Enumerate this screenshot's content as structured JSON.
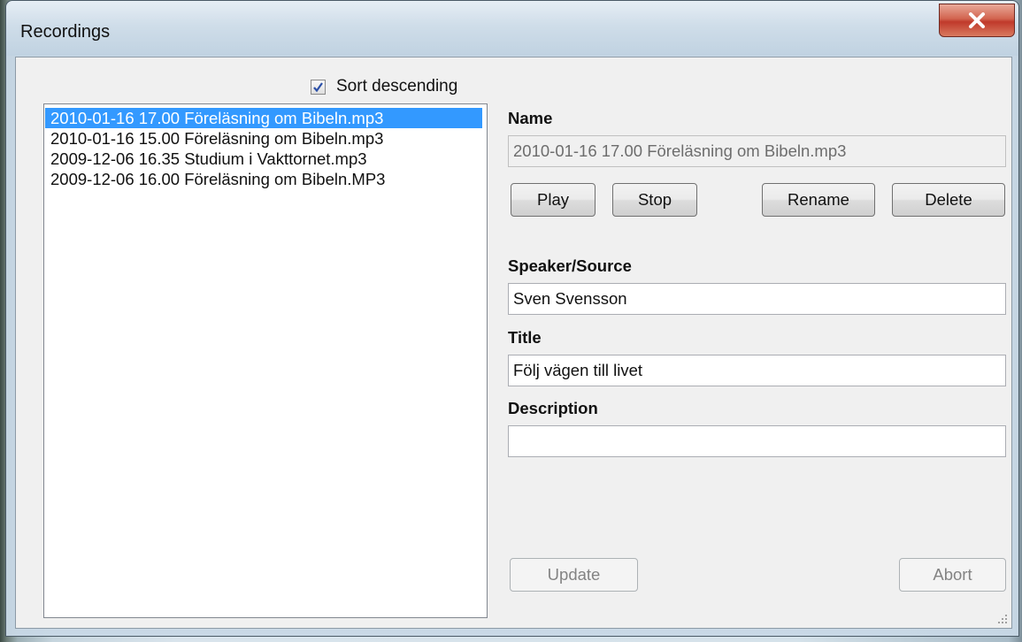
{
  "window": {
    "title": "Recordings",
    "close_label": "X"
  },
  "sort": {
    "label": "Sort descending",
    "checked": true
  },
  "recordings": [
    "2010-01-16 17.00 Föreläsning om Bibeln.mp3",
    "2010-01-16 15.00 Föreläsning om Bibeln.mp3",
    "2009-12-06 16.35 Studium i Vakttornet.mp3",
    "2009-12-06 16.00 Föreläsning om Bibeln.MP3"
  ],
  "selected_index": 0,
  "details": {
    "name_label": "Name",
    "name_value": "2010-01-16 17.00 Föreläsning om Bibeln.mp3",
    "speaker_label": "Speaker/Source",
    "speaker_value": "Sven Svensson",
    "title_label": "Title",
    "title_value": "Följ vägen till livet",
    "description_label": "Description",
    "description_value": ""
  },
  "buttons": {
    "play": "Play",
    "stop": "Stop",
    "rename": "Rename",
    "delete": "Delete",
    "update": "Update",
    "abort": "Abort"
  },
  "colors": {
    "selection": "#3399ff",
    "close_button": "#c0392b"
  }
}
